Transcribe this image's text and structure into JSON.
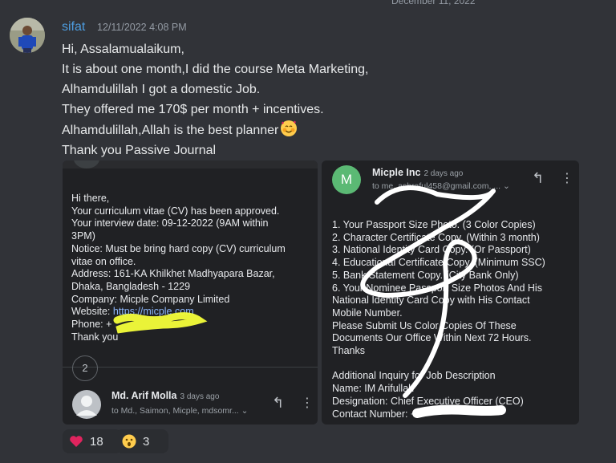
{
  "header": {
    "top_date": "December 11, 2022"
  },
  "message": {
    "username": "sifat",
    "timestamp": "12/11/2022 4:08 PM",
    "lines": [
      "Hi, Assalamualaikum,",
      "It is about one month,I did the course Meta Marketing,",
      "Alhamdulillah I got a domestic Job.",
      "They offered me 170$ per month + incentives.",
      "Alhamdulillah,Allah is the best planner",
      "Thank you Passive Journal"
    ],
    "emoji": "smiling-face-with-hearts"
  },
  "left_email": {
    "greeting": "Hi there,",
    "lines": [
      "Your curriculum vitae (CV) has been approved.",
      "Your interview date: 09-12-2022 (9AM within",
      "3PM)",
      "Notice: Must be bring hard copy (CV) curriculum",
      "vitae on office.",
      "Address: 161-KA Khilkhet Madhyapara Bazar,",
      "Dhaka, Bangladesh - 1229",
      "Company: Micple Company Limited"
    ],
    "website_label": "Website: ",
    "website_link": "https://micple.com",
    "phone_label": "Phone: +",
    "closing": "Thank you",
    "collapsed_count": "2",
    "sender_name": "Md. Arif Molla",
    "sender_date": "3 days ago",
    "sender_to": "to Md., Saimon, Micple, mdsomr..."
  },
  "right_email": {
    "sender_initial": "M",
    "sender_name": "Micple Inc",
    "sender_date": "2 days ago",
    "sender_to": "to me, ashraful458@gmail.com, ...",
    "lines": [
      "1. Your Passport Size Photo. (3 Color Copies)",
      "2. Character Certificate Copy. (Within 3 month)",
      "3. National Identity Card Copy. (Or Passport)",
      "4. Educational Certificate Copy. (Minimum SSC)",
      "5. Bank Statement Copy. (City Bank Only)",
      "6. Your Nominee Passport Size Photos And His",
      "National Identity Card Copy with His Contact",
      "Mobile Number.",
      "Please Submit Us Color Copies Of These",
      "Documents Our Office Within Next 72 Hours.",
      "Thanks",
      "",
      "Additional Inquiry for Job Description",
      "Name: IM Arifullah",
      "Designation: Chief Executive Officer (CEO)",
      "Contact Number: +"
    ]
  },
  "reactions": [
    {
      "icon": "heart-icon",
      "count": "18",
      "color": "#e0245e"
    },
    {
      "icon": "surprised-face-icon",
      "count": "3",
      "color": "#ffcc4d"
    }
  ]
}
